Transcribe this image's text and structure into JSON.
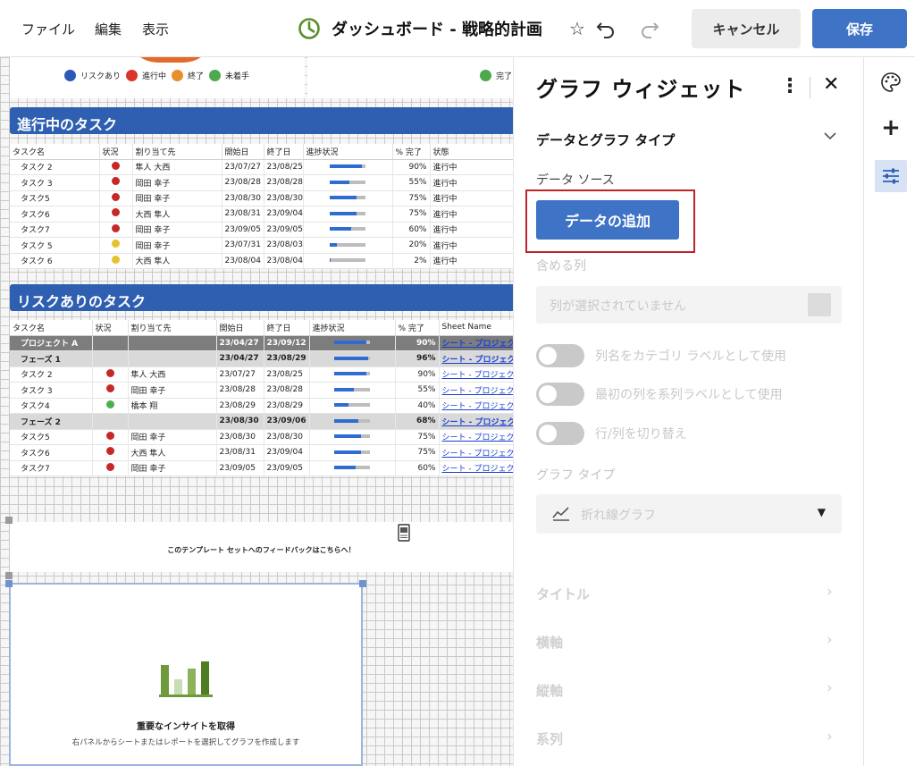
{
  "menu": {
    "file": "ファイル",
    "edit": "編集",
    "view": "表示"
  },
  "doc_title": "ダッシュボード - 戦略的計画",
  "toolbar": {
    "cancel_label": "キャンセル",
    "save_label": "保存"
  },
  "colors": {
    "accent": "#3f73c5",
    "section_blue": "#2f5fb0",
    "red_dot": "#c62828",
    "yellow_dot": "#e6c12e",
    "green_dot": "#4caf50",
    "orange_dot": "#e37a2a",
    "highlight_border": "#c0232b"
  },
  "legend": {
    "items": [
      {
        "label": "リスクあり",
        "color": "#2b59b5"
      },
      {
        "label": "進行中",
        "color": "#d9352b"
      },
      {
        "label": "終了",
        "color": "#e8902d"
      },
      {
        "label": "未着手",
        "color": "#4ea84e"
      }
    ],
    "right_label": "完了"
  },
  "in_progress": {
    "title": "進行中のタスク",
    "headers": [
      "タスク名",
      "状況",
      "割り当て先",
      "開始日",
      "終了日",
      "進捗状況",
      "% 完了",
      "状態"
    ],
    "rows": [
      {
        "name": "タスク 2",
        "dot": "red",
        "assignee": "隼人 大西",
        "start": "23/07/27",
        "end": "23/08/25",
        "pct": "90%",
        "progress": 0.9,
        "state": "進行中"
      },
      {
        "name": "タスク 3",
        "dot": "red",
        "assignee": "岡田 幸子",
        "start": "23/08/28",
        "end": "23/08/28",
        "pct": "55%",
        "progress": 0.55,
        "state": "進行中"
      },
      {
        "name": "タスク5",
        "dot": "red",
        "assignee": "岡田 幸子",
        "start": "23/08/30",
        "end": "23/08/30",
        "pct": "75%",
        "progress": 0.75,
        "state": "進行中"
      },
      {
        "name": "タスク6",
        "dot": "red",
        "assignee": "大西 隼人",
        "start": "23/08/31",
        "end": "23/09/04",
        "pct": "75%",
        "progress": 0.75,
        "state": "進行中"
      },
      {
        "name": "タスク7",
        "dot": "red",
        "assignee": "岡田 幸子",
        "start": "23/09/05",
        "end": "23/09/05",
        "pct": "60%",
        "progress": 0.6,
        "state": "進行中"
      },
      {
        "name": "タスク 5",
        "dot": "yellow",
        "assignee": "岡田 幸子",
        "start": "23/07/31",
        "end": "23/08/03",
        "pct": "20%",
        "progress": 0.2,
        "state": "進行中"
      },
      {
        "name": "タスク 6",
        "dot": "yellow",
        "assignee": "大西 隼人",
        "start": "23/08/04",
        "end": "23/08/04",
        "pct": "2%",
        "progress": 0.02,
        "state": "進行中"
      }
    ]
  },
  "at_risk": {
    "title": "リスクありのタスク",
    "headers": [
      "タスク名",
      "状況",
      "割り当て先",
      "開始日",
      "終了日",
      "進捗状況",
      "% 完了",
      "Sheet Name"
    ],
    "rows": [
      {
        "kind": "proj",
        "name": "プロジェクト A",
        "dot": "",
        "assignee": "",
        "start": "23/04/27",
        "end": "23/09/12",
        "pct": "90%",
        "progress": 0.9,
        "sheet": "シート - プロジェク"
      },
      {
        "kind": "phase",
        "name": "フェーズ 1",
        "dot": "",
        "assignee": "",
        "start": "23/04/27",
        "end": "23/08/29",
        "pct": "96%",
        "progress": 0.96,
        "sheet": "シート - プロジェク"
      },
      {
        "kind": "task",
        "name": "タスク 2",
        "dot": "red",
        "assignee": "隼人 大西",
        "start": "23/07/27",
        "end": "23/08/25",
        "pct": "90%",
        "progress": 0.9,
        "sheet": "シート - プロジェク"
      },
      {
        "kind": "task",
        "name": "タスク 3",
        "dot": "red",
        "assignee": "岡田 幸子",
        "start": "23/08/28",
        "end": "23/08/28",
        "pct": "55%",
        "progress": 0.55,
        "sheet": "シート - プロジェク"
      },
      {
        "kind": "task",
        "name": "タスク4",
        "dot": "green",
        "assignee": "橋本 翔",
        "start": "23/08/29",
        "end": "23/08/29",
        "pct": "40%",
        "progress": 0.4,
        "sheet": "シート - プロジェク"
      },
      {
        "kind": "phase",
        "name": "フェーズ 2",
        "dot": "",
        "assignee": "",
        "start": "23/08/30",
        "end": "23/09/06",
        "pct": "68%",
        "progress": 0.68,
        "sheet": "シート - プロジェク"
      },
      {
        "kind": "task",
        "name": "タスク5",
        "dot": "red",
        "assignee": "岡田 幸子",
        "start": "23/08/30",
        "end": "23/08/30",
        "pct": "75%",
        "progress": 0.75,
        "sheet": "シート - プロジェク"
      },
      {
        "kind": "task",
        "name": "タスク6",
        "dot": "red",
        "assignee": "大西 隼人",
        "start": "23/08/31",
        "end": "23/09/04",
        "pct": "75%",
        "progress": 0.75,
        "sheet": "シート - プロジェク"
      },
      {
        "kind": "task",
        "name": "タスク7",
        "dot": "red",
        "assignee": "岡田 幸子",
        "start": "23/09/05",
        "end": "23/09/05",
        "pct": "60%",
        "progress": 0.6,
        "sheet": "シート - プロジェク"
      }
    ]
  },
  "feedback": {
    "text": "このテンプレート セットへのフィードバックはこちらへ！"
  },
  "chart_widget": {
    "title": "重要なインサイトを取得",
    "subtitle": "右パネルからシートまたはレポートを選択してグラフを作成します"
  },
  "panel": {
    "title": "グラフ ウィジェット",
    "section": "データとグラフ タイプ",
    "data_source_label": "データ ソース",
    "add_data_label": "データの追加",
    "include_cols_label": "含める列",
    "cols_placeholder": "列が選択されていません",
    "toggles": [
      {
        "label": "列名をカテゴリ ラベルとして使用",
        "on": false
      },
      {
        "label": "最初の列を系列ラベルとして使用",
        "on": false
      },
      {
        "label": "行/列を切り替え",
        "on": false
      }
    ],
    "graph_type_label": "グラフ タイプ",
    "graph_type_value": "折れ線グラフ",
    "collapsed_sections": [
      "タイトル",
      "横軸",
      "縦軸",
      "系列"
    ]
  },
  "right_toolbar": {
    "icons": [
      "palette-icon",
      "add-icon",
      "sliders-icon"
    ]
  }
}
